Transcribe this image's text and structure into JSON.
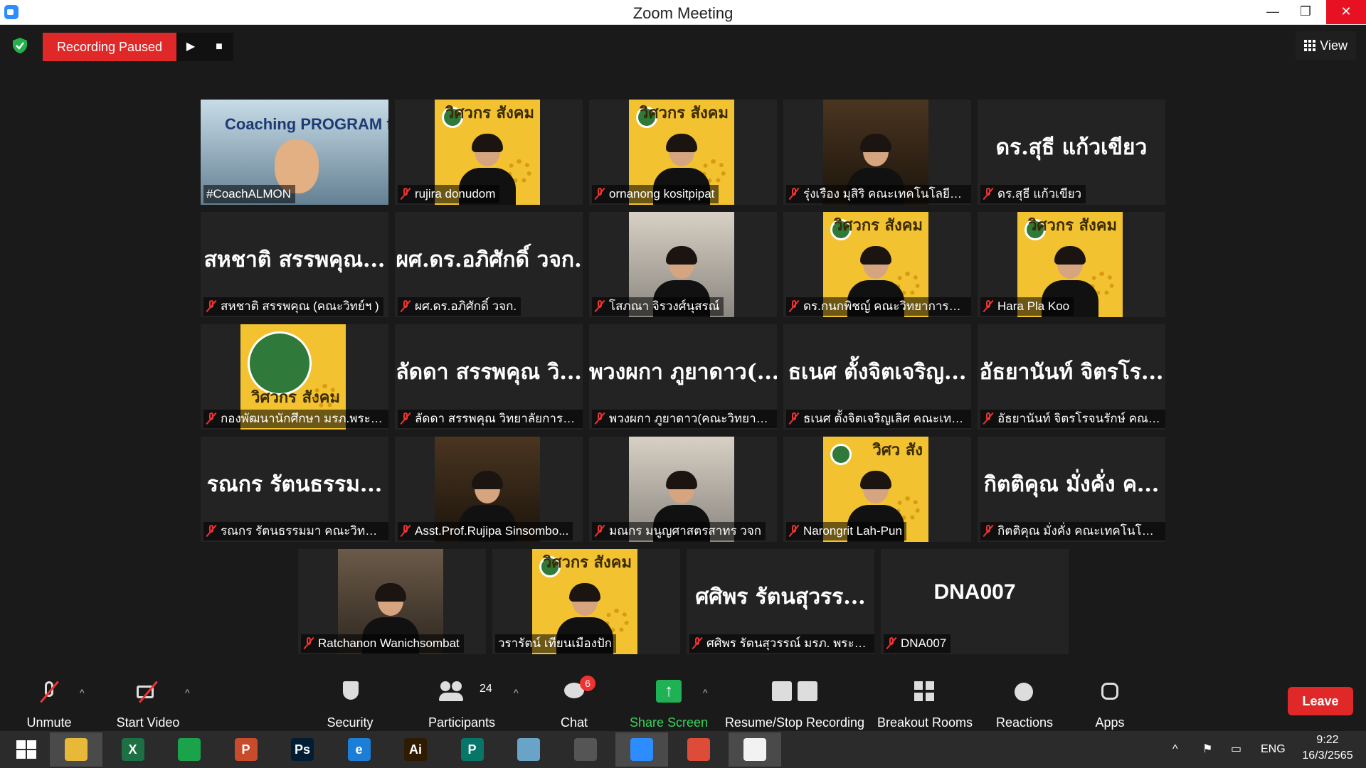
{
  "window": {
    "title": "Zoom Meeting"
  },
  "topbar": {
    "recording_status": "Recording Paused",
    "view_label": "View"
  },
  "participants": [
    {
      "video": "coach",
      "name": "#CoachALMON",
      "banner": "Coaching PROGRAM for Trainer",
      "active": true,
      "mic_off": false
    },
    {
      "video": "poster",
      "name": "rujira donudom",
      "poster_text": "วิศวกร สังคม",
      "mic_off": true
    },
    {
      "video": "poster",
      "name": "ornanong kositpipat",
      "poster_text": "วิศวกร สังคม",
      "mic_off": true
    },
    {
      "video": "photo-dark",
      "name": "รุ่งเรือง มุสิริ คณะเทคโนโลยีอุตส...",
      "mic_off": true
    },
    {
      "video": "none",
      "display": "ดร.สุธี แก้วเขียว",
      "name": "ดร.สุธี แก้วเขียว",
      "mic_off": true
    },
    {
      "video": "none",
      "display": "สหชาติ สรรพคุณ...",
      "name": "สหชาติ สรรพคุณ (คณะวิทย์ฯ )",
      "mic_off": true
    },
    {
      "video": "none",
      "display": "ผศ.ดร.อภิศักดิ์ วจก.",
      "name": "ผศ.ดร.อภิศักดิ์ วจก.",
      "mic_off": true
    },
    {
      "video": "photo-light",
      "name": "โสภณา จิรวงศ์นุสรณ์",
      "mic_off": true
    },
    {
      "video": "poster",
      "name": "ดร.กนกพิชญ์ คณะวิทยาการจัด...",
      "poster_text": "วิศวกร สังคม",
      "mic_off": true
    },
    {
      "video": "poster",
      "name": "Hara Pla Koo",
      "poster_text": "วิศวกร สังคม",
      "mic_off": true
    },
    {
      "video": "poster-seal",
      "name": "กองพัฒนานักศึกษา มรภ.พระนคร",
      "poster_text": "วิศวกร สังคม",
      "mic_off": true
    },
    {
      "video": "none",
      "display": "ลัดดา สรรพคุณ วิ...",
      "name": "ลัดดา สรรพคุณ วิทยาลัยการฝึ...",
      "mic_off": true
    },
    {
      "video": "none",
      "display": "พวงผกา ภูยาดาว(...",
      "name": "พวงผกา ภูยาดาว(คณะวิทยาศา...",
      "mic_off": true
    },
    {
      "video": "none",
      "display": "ธเนศ ตั้งจิตเจริญ...",
      "name": "ธเนศ ตั้งจิตเจริญเลิศ คณะเทคโน...",
      "mic_off": true
    },
    {
      "video": "none",
      "display": "อัธยานันท์ จิตรโร...",
      "name": "อัธยานันท์ จิตรโรจนรักษ์ คณะเท...",
      "mic_off": true
    },
    {
      "video": "none",
      "display": "รณกร รัตนธรรม...",
      "name": "รณกร รัตนธรรมมา คณะวิทยาศ...",
      "mic_off": true
    },
    {
      "video": "photo-dark",
      "name": "Asst.Prof.Rujipa Sinsombo...",
      "mic_off": true
    },
    {
      "video": "photo-light",
      "name": "มณกร มนูญศาสตรสาทร วจก",
      "mic_off": true
    },
    {
      "video": "poster",
      "name": "Narongrit Lah-Pun",
      "poster_text": "วิศว สัง",
      "mic_off": true
    },
    {
      "video": "none",
      "display": "กิตติคุณ มั่งคั่ง ค...",
      "name": "กิตติคุณ มั่งคั่ง คณะเทคโนโลยีอุ...",
      "mic_off": true
    },
    {
      "video": "photo-rest",
      "name": "Ratchanon Wanichsombat",
      "mic_off": true
    },
    {
      "video": "poster",
      "name": "วรารัตน์ เทียนเมืองปัก",
      "poster_text": "วิศวกร สังคม",
      "mic_off": false
    },
    {
      "video": "none",
      "display": "ศศิพร รัตนสุวรร...",
      "name": "ศศิพร รัตนสุวรรณ์ มรภ. พระนคร",
      "mic_off": true
    },
    {
      "video": "none",
      "display": "DNA007",
      "name": "DNA007",
      "mic_off": true
    }
  ],
  "toolbar": {
    "unmute": "Unmute",
    "start_video": "Start Video",
    "security": "Security",
    "participants": "Participants",
    "participants_count": "24",
    "chat": "Chat",
    "chat_badge": "6",
    "share_screen": "Share Screen",
    "recording": "Resume/Stop Recording",
    "breakout": "Breakout Rooms",
    "reactions": "Reactions",
    "apps": "Apps",
    "leave": "Leave"
  },
  "taskbar": {
    "apps": [
      {
        "name": "windows-start",
        "glyph": "",
        "color": "#2b2b2b"
      },
      {
        "name": "file-explorer",
        "glyph": "",
        "color": "#e8b838"
      },
      {
        "name": "excel",
        "glyph": "X",
        "color": "#1d7044"
      },
      {
        "name": "store",
        "glyph": "",
        "color": "#1aa34a"
      },
      {
        "name": "powerpoint",
        "glyph": "P",
        "color": "#c84b2b"
      },
      {
        "name": "photoshop",
        "glyph": "Ps",
        "color": "#001d34"
      },
      {
        "name": "internet-explorer",
        "glyph": "e",
        "color": "#1c7ed6"
      },
      {
        "name": "illustrator",
        "glyph": "Ai",
        "color": "#2e1b00"
      },
      {
        "name": "publisher",
        "glyph": "P",
        "color": "#077568"
      },
      {
        "name": "notes",
        "glyph": "",
        "color": "#6aa3c8"
      },
      {
        "name": "photoscape",
        "glyph": "",
        "color": "#555555"
      },
      {
        "name": "zoom",
        "glyph": "",
        "color": "#2d8cff"
      },
      {
        "name": "chrome",
        "glyph": "",
        "color": "#dd4b39"
      },
      {
        "name": "photos",
        "glyph": "",
        "color": "#f2f2f2"
      }
    ],
    "language": "ENG",
    "time": "9:22",
    "date": "16/3/2565"
  }
}
